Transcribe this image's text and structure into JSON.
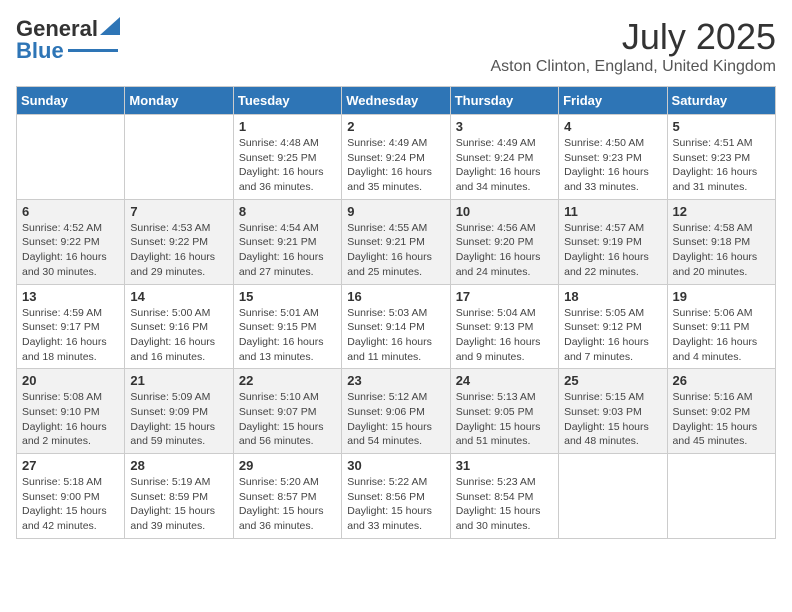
{
  "header": {
    "logo_line1": "General",
    "logo_line2": "Blue",
    "title": "July 2025",
    "subtitle": "Aston Clinton, England, United Kingdom"
  },
  "columns": [
    "Sunday",
    "Monday",
    "Tuesday",
    "Wednesday",
    "Thursday",
    "Friday",
    "Saturday"
  ],
  "weeks": [
    [
      {
        "day": "",
        "sunrise": "",
        "sunset": "",
        "daylight": ""
      },
      {
        "day": "",
        "sunrise": "",
        "sunset": "",
        "daylight": ""
      },
      {
        "day": "1",
        "sunrise": "Sunrise: 4:48 AM",
        "sunset": "Sunset: 9:25 PM",
        "daylight": "Daylight: 16 hours and 36 minutes."
      },
      {
        "day": "2",
        "sunrise": "Sunrise: 4:49 AM",
        "sunset": "Sunset: 9:24 PM",
        "daylight": "Daylight: 16 hours and 35 minutes."
      },
      {
        "day": "3",
        "sunrise": "Sunrise: 4:49 AM",
        "sunset": "Sunset: 9:24 PM",
        "daylight": "Daylight: 16 hours and 34 minutes."
      },
      {
        "day": "4",
        "sunrise": "Sunrise: 4:50 AM",
        "sunset": "Sunset: 9:23 PM",
        "daylight": "Daylight: 16 hours and 33 minutes."
      },
      {
        "day": "5",
        "sunrise": "Sunrise: 4:51 AM",
        "sunset": "Sunset: 9:23 PM",
        "daylight": "Daylight: 16 hours and 31 minutes."
      }
    ],
    [
      {
        "day": "6",
        "sunrise": "Sunrise: 4:52 AM",
        "sunset": "Sunset: 9:22 PM",
        "daylight": "Daylight: 16 hours and 30 minutes."
      },
      {
        "day": "7",
        "sunrise": "Sunrise: 4:53 AM",
        "sunset": "Sunset: 9:22 PM",
        "daylight": "Daylight: 16 hours and 29 minutes."
      },
      {
        "day": "8",
        "sunrise": "Sunrise: 4:54 AM",
        "sunset": "Sunset: 9:21 PM",
        "daylight": "Daylight: 16 hours and 27 minutes."
      },
      {
        "day": "9",
        "sunrise": "Sunrise: 4:55 AM",
        "sunset": "Sunset: 9:21 PM",
        "daylight": "Daylight: 16 hours and 25 minutes."
      },
      {
        "day": "10",
        "sunrise": "Sunrise: 4:56 AM",
        "sunset": "Sunset: 9:20 PM",
        "daylight": "Daylight: 16 hours and 24 minutes."
      },
      {
        "day": "11",
        "sunrise": "Sunrise: 4:57 AM",
        "sunset": "Sunset: 9:19 PM",
        "daylight": "Daylight: 16 hours and 22 minutes."
      },
      {
        "day": "12",
        "sunrise": "Sunrise: 4:58 AM",
        "sunset": "Sunset: 9:18 PM",
        "daylight": "Daylight: 16 hours and 20 minutes."
      }
    ],
    [
      {
        "day": "13",
        "sunrise": "Sunrise: 4:59 AM",
        "sunset": "Sunset: 9:17 PM",
        "daylight": "Daylight: 16 hours and 18 minutes."
      },
      {
        "day": "14",
        "sunrise": "Sunrise: 5:00 AM",
        "sunset": "Sunset: 9:16 PM",
        "daylight": "Daylight: 16 hours and 16 minutes."
      },
      {
        "day": "15",
        "sunrise": "Sunrise: 5:01 AM",
        "sunset": "Sunset: 9:15 PM",
        "daylight": "Daylight: 16 hours and 13 minutes."
      },
      {
        "day": "16",
        "sunrise": "Sunrise: 5:03 AM",
        "sunset": "Sunset: 9:14 PM",
        "daylight": "Daylight: 16 hours and 11 minutes."
      },
      {
        "day": "17",
        "sunrise": "Sunrise: 5:04 AM",
        "sunset": "Sunset: 9:13 PM",
        "daylight": "Daylight: 16 hours and 9 minutes."
      },
      {
        "day": "18",
        "sunrise": "Sunrise: 5:05 AM",
        "sunset": "Sunset: 9:12 PM",
        "daylight": "Daylight: 16 hours and 7 minutes."
      },
      {
        "day": "19",
        "sunrise": "Sunrise: 5:06 AM",
        "sunset": "Sunset: 9:11 PM",
        "daylight": "Daylight: 16 hours and 4 minutes."
      }
    ],
    [
      {
        "day": "20",
        "sunrise": "Sunrise: 5:08 AM",
        "sunset": "Sunset: 9:10 PM",
        "daylight": "Daylight: 16 hours and 2 minutes."
      },
      {
        "day": "21",
        "sunrise": "Sunrise: 5:09 AM",
        "sunset": "Sunset: 9:09 PM",
        "daylight": "Daylight: 15 hours and 59 minutes."
      },
      {
        "day": "22",
        "sunrise": "Sunrise: 5:10 AM",
        "sunset": "Sunset: 9:07 PM",
        "daylight": "Daylight: 15 hours and 56 minutes."
      },
      {
        "day": "23",
        "sunrise": "Sunrise: 5:12 AM",
        "sunset": "Sunset: 9:06 PM",
        "daylight": "Daylight: 15 hours and 54 minutes."
      },
      {
        "day": "24",
        "sunrise": "Sunrise: 5:13 AM",
        "sunset": "Sunset: 9:05 PM",
        "daylight": "Daylight: 15 hours and 51 minutes."
      },
      {
        "day": "25",
        "sunrise": "Sunrise: 5:15 AM",
        "sunset": "Sunset: 9:03 PM",
        "daylight": "Daylight: 15 hours and 48 minutes."
      },
      {
        "day": "26",
        "sunrise": "Sunrise: 5:16 AM",
        "sunset": "Sunset: 9:02 PM",
        "daylight": "Daylight: 15 hours and 45 minutes."
      }
    ],
    [
      {
        "day": "27",
        "sunrise": "Sunrise: 5:18 AM",
        "sunset": "Sunset: 9:00 PM",
        "daylight": "Daylight: 15 hours and 42 minutes."
      },
      {
        "day": "28",
        "sunrise": "Sunrise: 5:19 AM",
        "sunset": "Sunset: 8:59 PM",
        "daylight": "Daylight: 15 hours and 39 minutes."
      },
      {
        "day": "29",
        "sunrise": "Sunrise: 5:20 AM",
        "sunset": "Sunset: 8:57 PM",
        "daylight": "Daylight: 15 hours and 36 minutes."
      },
      {
        "day": "30",
        "sunrise": "Sunrise: 5:22 AM",
        "sunset": "Sunset: 8:56 PM",
        "daylight": "Daylight: 15 hours and 33 minutes."
      },
      {
        "day": "31",
        "sunrise": "Sunrise: 5:23 AM",
        "sunset": "Sunset: 8:54 PM",
        "daylight": "Daylight: 15 hours and 30 minutes."
      },
      {
        "day": "",
        "sunrise": "",
        "sunset": "",
        "daylight": ""
      },
      {
        "day": "",
        "sunrise": "",
        "sunset": "",
        "daylight": ""
      }
    ]
  ]
}
